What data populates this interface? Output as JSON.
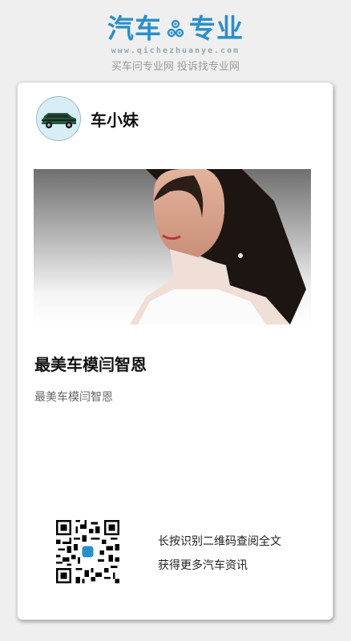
{
  "header": {
    "brand_left": "汽车",
    "brand_right": "专业",
    "domain": "www.qichezhuanye.com",
    "slogan": "买车问专业网 投诉找专业网"
  },
  "post": {
    "author": "车小妹",
    "title": "最美车模闫智恩",
    "summary": "最美车模闫智恩"
  },
  "footer": {
    "qr_hint_line1": "长按识别二维码查阅全文",
    "qr_hint_line2": "获得更多汽车资讯"
  },
  "colors": {
    "brand": "#2a8fc9",
    "background": "#efefef",
    "card": "#ffffff"
  }
}
